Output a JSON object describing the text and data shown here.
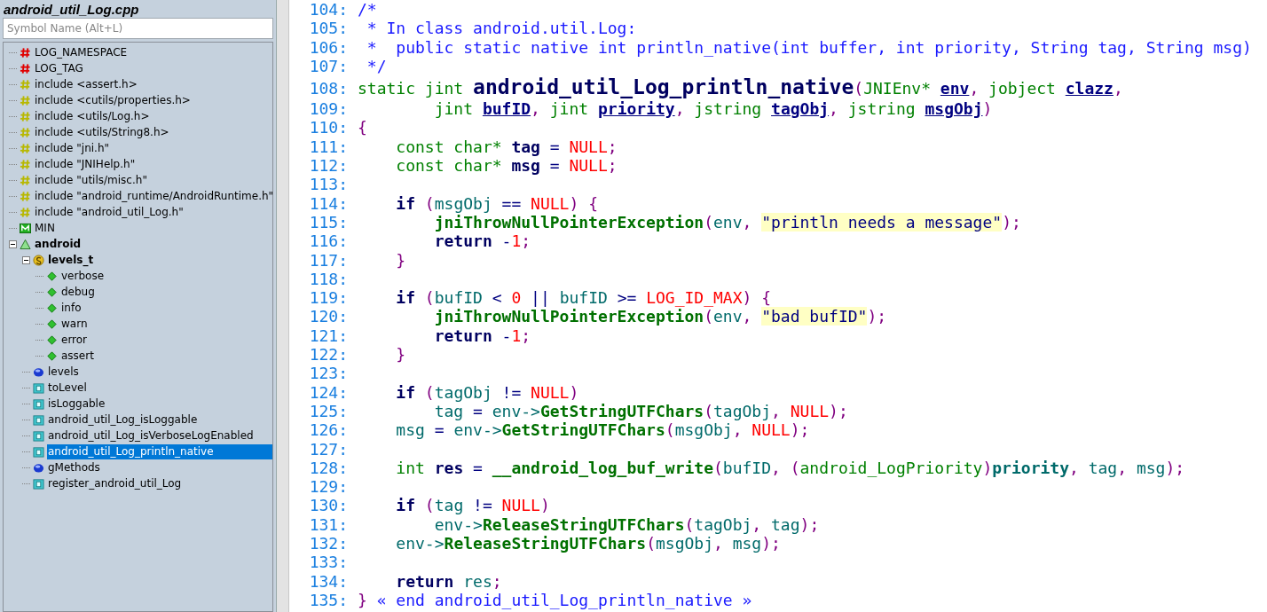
{
  "symbol_panel": {
    "title": "android_util_Log.cpp",
    "search": {
      "placeholder": "Symbol Name (Alt+L)"
    },
    "tree": [
      {
        "label": "LOG_NAMESPACE",
        "kind": "define",
        "selected": false
      },
      {
        "label": "LOG_TAG",
        "kind": "define",
        "selected": false
      },
      {
        "label": "include <assert.h>",
        "kind": "include",
        "selected": false
      },
      {
        "label": "include <cutils/properties.h>",
        "kind": "include",
        "selected": false
      },
      {
        "label": "include <utils/Log.h>",
        "kind": "include",
        "selected": false
      },
      {
        "label": "include <utils/String8.h>",
        "kind": "include",
        "selected": false
      },
      {
        "label": "include \"jni.h\"",
        "kind": "include",
        "selected": false
      },
      {
        "label": "include \"JNIHelp.h\"",
        "kind": "include",
        "selected": false
      },
      {
        "label": "include \"utils/misc.h\"",
        "kind": "include",
        "selected": false
      },
      {
        "label": "include \"android_runtime/AndroidRuntime.h\"",
        "kind": "include",
        "selected": false
      },
      {
        "label": "include \"android_util_Log.h\"",
        "kind": "include",
        "selected": false
      },
      {
        "label": "MIN",
        "kind": "macro",
        "selected": false
      },
      {
        "label": "android",
        "kind": "namespace",
        "selected": false,
        "expanded": true,
        "children": [
          {
            "label": "levels_t",
            "kind": "struct",
            "selected": false,
            "expanded": true,
            "children": [
              {
                "label": "verbose",
                "kind": "member",
                "selected": false
              },
              {
                "label": "debug",
                "kind": "member",
                "selected": false
              },
              {
                "label": "info",
                "kind": "member",
                "selected": false
              },
              {
                "label": "warn",
                "kind": "member",
                "selected": false
              },
              {
                "label": "error",
                "kind": "member",
                "selected": false
              },
              {
                "label": "assert",
                "kind": "member",
                "selected": false
              }
            ]
          },
          {
            "label": "levels",
            "kind": "variable",
            "selected": false
          },
          {
            "label": "toLevel",
            "kind": "function",
            "selected": false
          },
          {
            "label": "isLoggable",
            "kind": "function",
            "selected": false
          },
          {
            "label": "android_util_Log_isLoggable",
            "kind": "function",
            "selected": false
          },
          {
            "label": "android_util_Log_isVerboseLogEnabled",
            "kind": "function",
            "selected": false
          },
          {
            "label": "android_util_Log_println_native",
            "kind": "function",
            "selected": true
          },
          {
            "label": "gMethods",
            "kind": "variable",
            "selected": false
          },
          {
            "label": "register_android_util_Log",
            "kind": "function",
            "selected": false
          }
        ]
      }
    ]
  },
  "editor": {
    "lines": [
      {
        "no": "104:",
        "tokens": [
          {
            "kind": "comment",
            "t": "/*"
          }
        ]
      },
      {
        "no": "105:",
        "tokens": [
          {
            "kind": "comment",
            "t": " * In class android.util.Log:"
          }
        ]
      },
      {
        "no": "106:",
        "tokens": [
          {
            "kind": "comment",
            "t": " *  public static native int println_native(int buffer, int priority, String tag, String msg)"
          }
        ]
      },
      {
        "no": "107:",
        "tokens": [
          {
            "kind": "comment",
            "t": " */"
          }
        ]
      },
      {
        "no": "108:",
        "tokens": [
          {
            "kind": "type",
            "t": "static jint "
          },
          {
            "kind": "definition",
            "t": "android_util_Log_println_native"
          },
          {
            "kind": "punct",
            "t": "("
          },
          {
            "kind": "type",
            "t": "JNIEnv* "
          },
          {
            "kind": "param",
            "t": "env"
          },
          {
            "kind": "punct",
            "t": ", "
          },
          {
            "kind": "type",
            "t": "jobject "
          },
          {
            "kind": "param",
            "t": "clazz"
          },
          {
            "kind": "punct",
            "t": ","
          }
        ]
      },
      {
        "no": "109:",
        "tokens": [
          {
            "kind": "type",
            "t": "        jint "
          },
          {
            "kind": "param",
            "t": "bufID"
          },
          {
            "kind": "punct",
            "t": ", "
          },
          {
            "kind": "type",
            "t": "jint "
          },
          {
            "kind": "param",
            "t": "priority"
          },
          {
            "kind": "punct",
            "t": ", "
          },
          {
            "kind": "type",
            "t": "jstring "
          },
          {
            "kind": "param",
            "t": "tagObj"
          },
          {
            "kind": "punct",
            "t": ", "
          },
          {
            "kind": "type",
            "t": "jstring "
          },
          {
            "kind": "param",
            "t": "msgObj"
          },
          {
            "kind": "punct",
            "t": ")"
          }
        ]
      },
      {
        "no": "110:",
        "tokens": [
          {
            "kind": "punct",
            "t": "{"
          }
        ]
      },
      {
        "no": "111:",
        "tokens": [
          {
            "kind": "type",
            "t": "    const char* "
          },
          {
            "kind": "local",
            "t": "tag"
          },
          {
            "kind": "plain",
            "t": " = "
          },
          {
            "kind": "literal",
            "t": "NULL"
          },
          {
            "kind": "punct",
            "t": ";"
          }
        ]
      },
      {
        "no": "112:",
        "tokens": [
          {
            "kind": "type",
            "t": "    const char* "
          },
          {
            "kind": "local",
            "t": "msg"
          },
          {
            "kind": "plain",
            "t": " = "
          },
          {
            "kind": "literal",
            "t": "NULL"
          },
          {
            "kind": "punct",
            "t": ";"
          }
        ]
      },
      {
        "no": "113:"
      },
      {
        "no": "114:",
        "tokens": [
          {
            "kind": "keyword",
            "t": "    if"
          },
          {
            "kind": "punct",
            "t": " ("
          },
          {
            "kind": "variable",
            "t": "msgObj"
          },
          {
            "kind": "plain",
            "t": " == "
          },
          {
            "kind": "literal",
            "t": "NULL"
          },
          {
            "kind": "punct",
            "t": ") {"
          }
        ]
      },
      {
        "no": "115:",
        "tokens": [
          {
            "kind": "call",
            "t": "        jniThrowNullPointerException"
          },
          {
            "kind": "punct",
            "t": "("
          },
          {
            "kind": "variable",
            "t": "env"
          },
          {
            "kind": "punct",
            "t": ", "
          },
          {
            "kind": "string",
            "t": "\"println needs a message\""
          },
          {
            "kind": "punct",
            "t": ");"
          }
        ]
      },
      {
        "no": "116:",
        "tokens": [
          {
            "kind": "keyword",
            "t": "        return"
          },
          {
            "kind": "plain",
            "t": " -"
          },
          {
            "kind": "literal",
            "t": "1"
          },
          {
            "kind": "punct",
            "t": ";"
          }
        ]
      },
      {
        "no": "117:",
        "tokens": [
          {
            "kind": "punct",
            "t": "    }"
          }
        ]
      },
      {
        "no": "118:"
      },
      {
        "no": "119:",
        "tokens": [
          {
            "kind": "keyword",
            "t": "    if"
          },
          {
            "kind": "punct",
            "t": " ("
          },
          {
            "kind": "variable",
            "t": "bufID"
          },
          {
            "kind": "plain",
            "t": " < "
          },
          {
            "kind": "literal",
            "t": "0"
          },
          {
            "kind": "plain",
            "t": " || "
          },
          {
            "kind": "variable",
            "t": "bufID"
          },
          {
            "kind": "plain",
            "t": " >= "
          },
          {
            "kind": "literal",
            "t": "LOG_ID_MAX"
          },
          {
            "kind": "punct",
            "t": ") {"
          }
        ]
      },
      {
        "no": "120:",
        "tokens": [
          {
            "kind": "call",
            "t": "        jniThrowNullPointerException"
          },
          {
            "kind": "punct",
            "t": "("
          },
          {
            "kind": "variable",
            "t": "env"
          },
          {
            "kind": "punct",
            "t": ", "
          },
          {
            "kind": "string",
            "t": "\"bad bufID\""
          },
          {
            "kind": "punct",
            "t": ");"
          }
        ]
      },
      {
        "no": "121:",
        "tokens": [
          {
            "kind": "keyword",
            "t": "        return"
          },
          {
            "kind": "plain",
            "t": " -"
          },
          {
            "kind": "literal",
            "t": "1"
          },
          {
            "kind": "punct",
            "t": ";"
          }
        ]
      },
      {
        "no": "122:",
        "tokens": [
          {
            "kind": "punct",
            "t": "    }"
          }
        ]
      },
      {
        "no": "123:"
      },
      {
        "no": "124:",
        "tokens": [
          {
            "kind": "keyword",
            "t": "    if"
          },
          {
            "kind": "punct",
            "t": " ("
          },
          {
            "kind": "variable",
            "t": "tagObj"
          },
          {
            "kind": "plain",
            "t": " != "
          },
          {
            "kind": "literal",
            "t": "NULL"
          },
          {
            "kind": "punct",
            "t": ")"
          }
        ]
      },
      {
        "no": "125:",
        "tokens": [
          {
            "kind": "variable",
            "t": "        tag"
          },
          {
            "kind": "plain",
            "t": " = "
          },
          {
            "kind": "variable",
            "t": "env->"
          },
          {
            "kind": "call",
            "t": "GetStringUTFChars"
          },
          {
            "kind": "punct",
            "t": "("
          },
          {
            "kind": "variable",
            "t": "tagObj"
          },
          {
            "kind": "punct",
            "t": ", "
          },
          {
            "kind": "literal",
            "t": "NULL"
          },
          {
            "kind": "punct",
            "t": ");"
          }
        ]
      },
      {
        "no": "126:",
        "tokens": [
          {
            "kind": "variable",
            "t": "    msg"
          },
          {
            "kind": "plain",
            "t": " = "
          },
          {
            "kind": "variable",
            "t": "env->"
          },
          {
            "kind": "call",
            "t": "GetStringUTFChars"
          },
          {
            "kind": "punct",
            "t": "("
          },
          {
            "kind": "variable",
            "t": "msgObj"
          },
          {
            "kind": "punct",
            "t": ", "
          },
          {
            "kind": "literal",
            "t": "NULL"
          },
          {
            "kind": "punct",
            "t": ");"
          }
        ]
      },
      {
        "no": "127:"
      },
      {
        "no": "128:",
        "tokens": [
          {
            "kind": "type",
            "t": "    int "
          },
          {
            "kind": "local",
            "t": "res"
          },
          {
            "kind": "plain",
            "t": " = "
          },
          {
            "kind": "call",
            "t": "__android_log_buf_write"
          },
          {
            "kind": "punct",
            "t": "("
          },
          {
            "kind": "variable",
            "t": "bufID"
          },
          {
            "kind": "punct",
            "t": ", ("
          },
          {
            "kind": "type",
            "t": "android_LogPriority"
          },
          {
            "kind": "punct",
            "t": ")"
          },
          {
            "kind": "variable-bold",
            "t": "priority"
          },
          {
            "kind": "punct",
            "t": ", "
          },
          {
            "kind": "variable",
            "t": "tag"
          },
          {
            "kind": "punct",
            "t": ", "
          },
          {
            "kind": "variable",
            "t": "msg"
          },
          {
            "kind": "punct",
            "t": ");"
          }
        ]
      },
      {
        "no": "129:"
      },
      {
        "no": "130:",
        "tokens": [
          {
            "kind": "keyword",
            "t": "    if"
          },
          {
            "kind": "punct",
            "t": " ("
          },
          {
            "kind": "variable",
            "t": "tag"
          },
          {
            "kind": "plain",
            "t": " != "
          },
          {
            "kind": "literal",
            "t": "NULL"
          },
          {
            "kind": "punct",
            "t": ")"
          }
        ]
      },
      {
        "no": "131:",
        "tokens": [
          {
            "kind": "variable",
            "t": "        env->"
          },
          {
            "kind": "call",
            "t": "ReleaseStringUTFChars"
          },
          {
            "kind": "punct",
            "t": "("
          },
          {
            "kind": "variable",
            "t": "tagObj"
          },
          {
            "kind": "punct",
            "t": ", "
          },
          {
            "kind": "variable",
            "t": "tag"
          },
          {
            "kind": "punct",
            "t": ");"
          }
        ]
      },
      {
        "no": "132:",
        "tokens": [
          {
            "kind": "variable",
            "t": "    env->"
          },
          {
            "kind": "call",
            "t": "ReleaseStringUTFChars"
          },
          {
            "kind": "punct",
            "t": "("
          },
          {
            "kind": "variable",
            "t": "msgObj"
          },
          {
            "kind": "punct",
            "t": ", "
          },
          {
            "kind": "variable",
            "t": "msg"
          },
          {
            "kind": "punct",
            "t": ");"
          }
        ]
      },
      {
        "no": "133:"
      },
      {
        "no": "134:",
        "tokens": [
          {
            "kind": "keyword",
            "t": "    return"
          },
          {
            "kind": "variable",
            "t": " res"
          },
          {
            "kind": "punct",
            "t": ";"
          }
        ]
      },
      {
        "no": "135:",
        "tokens": [
          {
            "kind": "punct",
            "t": "}"
          },
          {
            "kind": "comment",
            "t": " « end android_util_Log_println_native »"
          }
        ]
      }
    ]
  }
}
